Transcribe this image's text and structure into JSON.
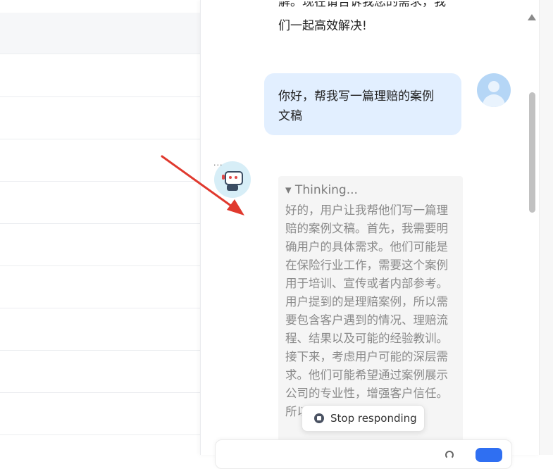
{
  "chat": {
    "previous_message": {
      "line1": "解。现在请告诉我您的需求，我",
      "line2": "们一起高效解决!"
    },
    "user_message": "你好，帮我写一篇理赔的案例文稿",
    "bot_typing_indicator": "···",
    "thinking": {
      "title": "▾ Thinking...",
      "body": "好的，用户让我帮他们写一篇理赔的案例文稿。首先，我需要明确用户的具体需求。他们可能是在保险行业工作，需要这个案例用于培训、宣传或者内部参考。用户提到的是理赔案例，所以需要包含客户遇到的情况、理赔流程、结果以及可能的经验教训。\n接下来，考虑用户可能的深层需求。他们可能希望通过案例展示公司的专业性，增强客户信任。所以案例"
    },
    "stop_button": "Stop responding"
  },
  "colors": {
    "user_bubble": "#e2efff",
    "thinking_bg": "#f5f5f5",
    "send_button": "#2f6ff2",
    "annotation_arrow": "#e0392e"
  }
}
